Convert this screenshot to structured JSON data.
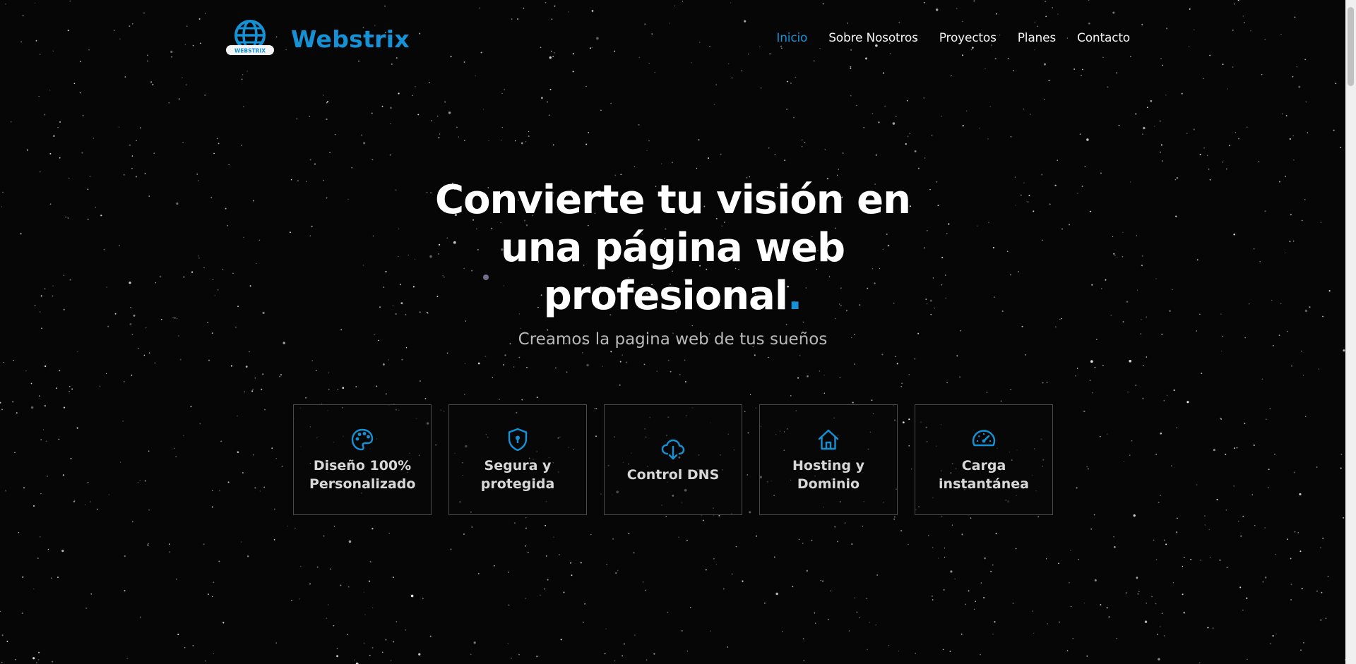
{
  "header": {
    "brand": "Webstrix",
    "logo_caption": "WEBSTRIX",
    "nav": [
      {
        "label": "Inicio",
        "active": true
      },
      {
        "label": "Sobre Nosotros",
        "active": false
      },
      {
        "label": "Proyectos",
        "active": false
      },
      {
        "label": "Planes",
        "active": false
      },
      {
        "label": "Contacto",
        "active": false
      }
    ]
  },
  "hero": {
    "title_line1": "Convierte tu visión en",
    "title_line2": "una página web",
    "title_line3": "profesional",
    "title_dot": ".",
    "subtitle": "Creamos la pagina web de tus sueños"
  },
  "features": [
    {
      "icon": "palette-icon",
      "label": "Diseño 100%\nPersonalizado"
    },
    {
      "icon": "shield-lock-icon",
      "label": "Segura y\nprotegida"
    },
    {
      "icon": "cloud-download-icon",
      "label": "Control DNS"
    },
    {
      "icon": "home-icon",
      "label": "Hosting y\nDominio"
    },
    {
      "icon": "speedometer-icon",
      "label": "Carga\ninstantánea"
    }
  ],
  "colors": {
    "accent": "#1592d6",
    "background": "#060606",
    "text": "#ffffff"
  }
}
